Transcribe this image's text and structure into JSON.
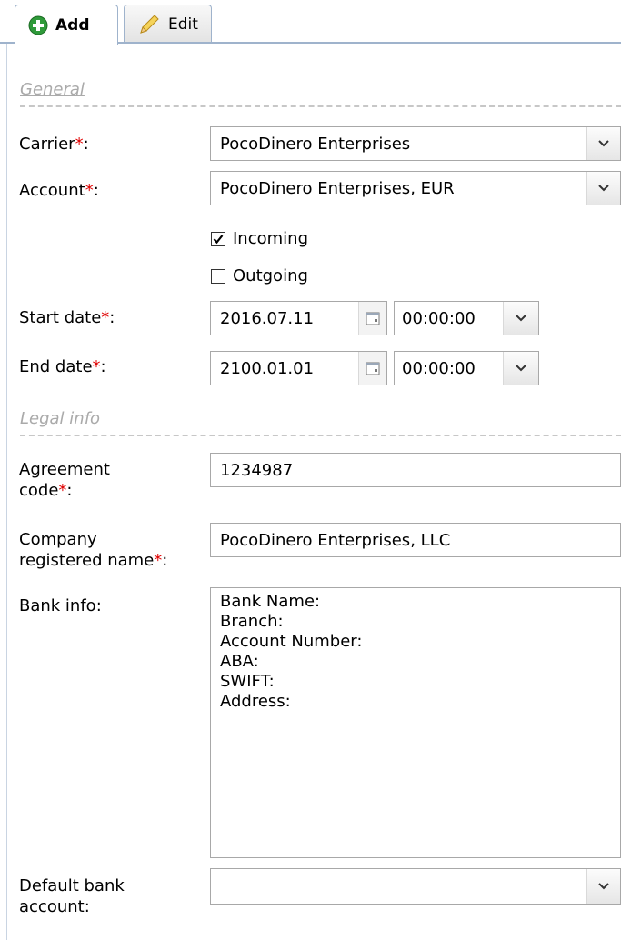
{
  "tabs": {
    "add_label": "Add",
    "edit_label": "Edit"
  },
  "sections": {
    "general": "General",
    "legal": "Legal info"
  },
  "fields": {
    "carrier": {
      "label": "Carrier",
      "value": "PocoDinero Enterprises"
    },
    "account": {
      "label": "Account",
      "value": "PocoDinero Enterprises, EUR"
    },
    "incoming": {
      "label": "Incoming",
      "checked": true
    },
    "outgoing": {
      "label": "Outgoing",
      "checked": false
    },
    "start_date": {
      "label": "Start date",
      "date": "2016.07.11",
      "time": "00:00:00"
    },
    "end_date": {
      "label": "End date",
      "date": "2100.01.01",
      "time": "00:00:00"
    },
    "agreement_code": {
      "label_line1": "Agreement",
      "label_line2": "code",
      "value": "1234987"
    },
    "company_name": {
      "label_line1": "Company",
      "label_line2": "registered name",
      "value": "PocoDinero Enterprises, LLC"
    },
    "bank_info": {
      "label": "Bank info:",
      "value": "Bank Name:\nBranch:\nAccount Number:\nABA:\nSWIFT:\nAddress:"
    },
    "default_bank": {
      "label_line1": "Default bank",
      "label_line2": "account:",
      "value": ""
    }
  },
  "required_marker": "*",
  "colon": ":",
  "colors": {
    "required": "#e00000",
    "tab_border": "#9fb3cc",
    "legend": "#aaaaaa"
  }
}
